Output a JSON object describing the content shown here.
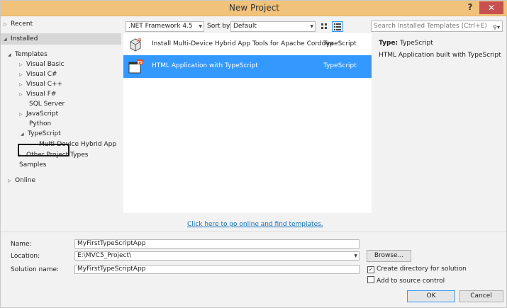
{
  "window": {
    "title": "New Project",
    "help": "?",
    "close": "✕"
  },
  "tree": {
    "recent": "Recent",
    "installed": "Installed",
    "templates": "Templates",
    "visual_basic": "Visual Basic",
    "visual_csharp": "Visual C#",
    "visual_cpp": "Visual C++",
    "visual_fsharp": "Visual F#",
    "sql_server": "SQL Server",
    "javascript": "JavaScript",
    "python": "Python",
    "typescript": "TypeScript",
    "multi_device": "Multi-Device Hybrid App",
    "other_project_types": "Other Project Types",
    "samples": "Samples",
    "online": "Online"
  },
  "toolbar": {
    "framework": ".NET Framework 4.5",
    "sort_label": "Sort by:",
    "sort_value": "Default"
  },
  "search": {
    "placeholder": "Search Installed Templates (Ctrl+E)"
  },
  "templates": [
    {
      "name": "Install Multi-Device Hybrid App Tools for Apache Cordova",
      "lang": "TypeScript",
      "badge": "JS"
    },
    {
      "name": "HTML Application with TypeScript",
      "lang": "TypeScript",
      "badge": "TS"
    }
  ],
  "online_link": "Click here to go online and find templates.",
  "details": {
    "type_label": "Type:",
    "type_value": "TypeScript",
    "description": "HTML Application built with TypeScript"
  },
  "form": {
    "name_label": "Name:",
    "name_value": "MyFirstTypeScriptApp",
    "location_label": "Location:",
    "location_value": "E:\\MVC5_Project\\",
    "solution_label": "Solution name:",
    "solution_value": "MyFirstTypeScriptApp",
    "browse": "Browse...",
    "create_dir": "Create directory for solution",
    "add_source": "Add to source control",
    "ok": "OK",
    "cancel": "Cancel"
  },
  "colors": {
    "accent": "#3399ff",
    "titlebar": "#f0c27a",
    "close": "#c75050"
  }
}
